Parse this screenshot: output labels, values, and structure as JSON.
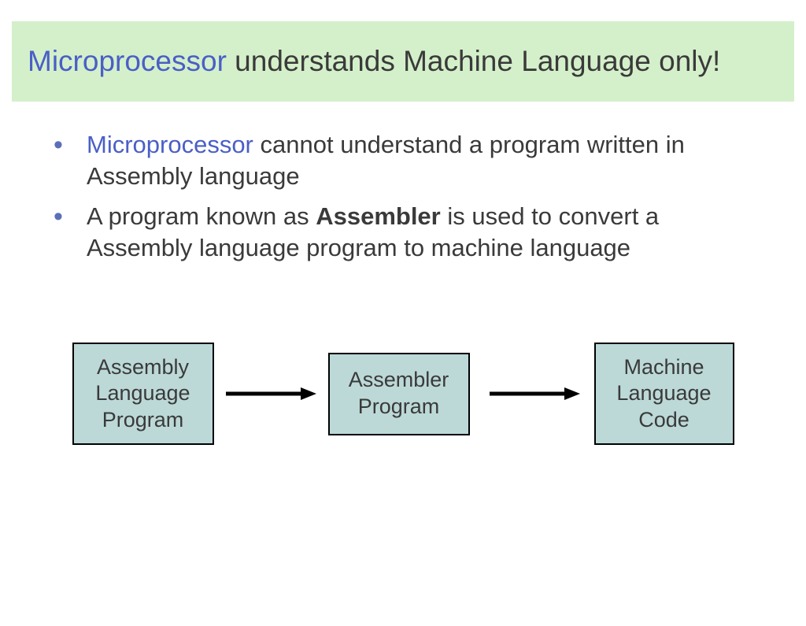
{
  "title": {
    "highlight": "Microprocessor",
    "rest": " understands Machine Language only!"
  },
  "bullets": [
    {
      "highlight": "Microprocessor",
      "rest": " cannot understand a program written in Assembly language"
    },
    {
      "part1": "A program known as ",
      "bold": "Assembler",
      "part2": " is used to convert a Assembly language program to machine language"
    }
  ],
  "diagram": {
    "box1": "Assembly\nLanguage\nProgram",
    "box2": "Assembler\nProgram",
    "box3": "Machine\nLanguage\nCode"
  }
}
